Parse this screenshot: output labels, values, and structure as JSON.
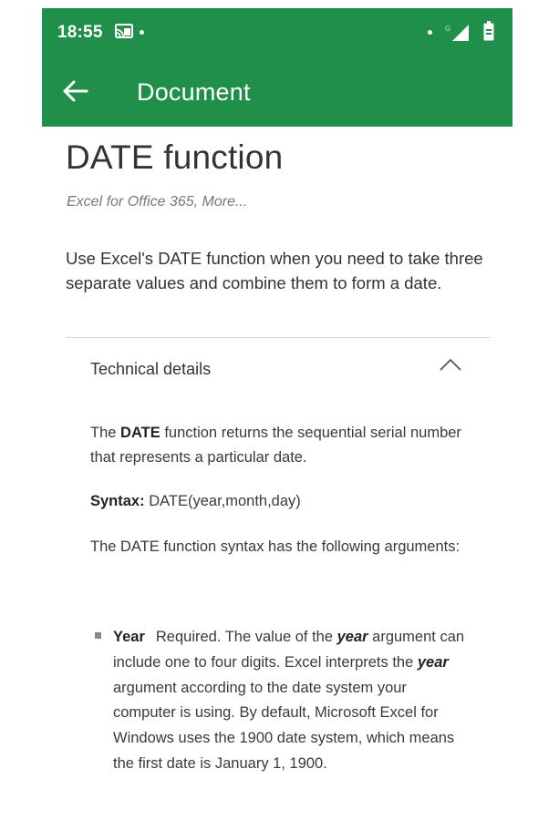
{
  "status_bar": {
    "time": "18:55",
    "icons": [
      "cast-icon",
      "notification-dot",
      "signal-icon",
      "battery-icon"
    ]
  },
  "app_bar": {
    "back_icon": "arrow-left-icon",
    "title": "Document",
    "background_color": "#1f8f4a"
  },
  "article": {
    "title": "DATE function",
    "applies_to": "Excel for Office 365, More...",
    "intro": "Use Excel's DATE function when you need to take three separate values and combine them to form a date.",
    "section": {
      "title": "Technical details",
      "state_icon": "chevron-up-icon",
      "para1": {
        "prefix": "The ",
        "bold": "DATE",
        "suffix": " function returns the sequential serial number that represents a particular date."
      },
      "syntax": {
        "label": "Syntax:",
        "value": " DATE(year,month,day)"
      },
      "para3": "The DATE function syntax has the following arguments:",
      "arguments": [
        {
          "term": "Year",
          "desc_1": "Required. The value of the ",
          "em_1": "year",
          "desc_2": " argument can include one to four digits. Excel interprets the ",
          "em_2": "year",
          "desc_3": " argument according to the date system your computer is using. By default, Microsoft Excel for Windows uses the 1900 date system, which means the first date is January 1, 1900."
        }
      ]
    }
  }
}
